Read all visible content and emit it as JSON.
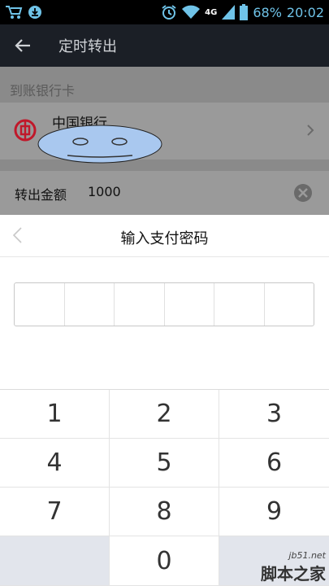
{
  "status_bar": {
    "battery_percent": "68%",
    "time": "20:02",
    "network": "4G",
    "icons": [
      "cart-icon",
      "download-icon",
      "alarm-icon",
      "wifi-icon",
      "signal-icon",
      "battery-icon"
    ]
  },
  "action_bar": {
    "title": "定时转出",
    "back_icon": "back-arrow-icon"
  },
  "background": {
    "section_label": "到账银行卡",
    "bank_name": "中国银行",
    "amount_label": "转出金额",
    "amount_value": "1000"
  },
  "dialog": {
    "title": "输入支付密码",
    "digits_entered": 0,
    "digits_total": 6
  },
  "keypad": {
    "keys": [
      "1",
      "2",
      "3",
      "4",
      "5",
      "6",
      "7",
      "8",
      "9",
      "",
      "0",
      ""
    ]
  },
  "watermark": {
    "url": "jb51.net",
    "name": "脚本之家"
  },
  "colors": {
    "status_accent": "#6fc3e8",
    "action_bar": "#1b1f26",
    "bank_logo": "#c0182a",
    "keypad_blank": "#e2e5ec"
  }
}
